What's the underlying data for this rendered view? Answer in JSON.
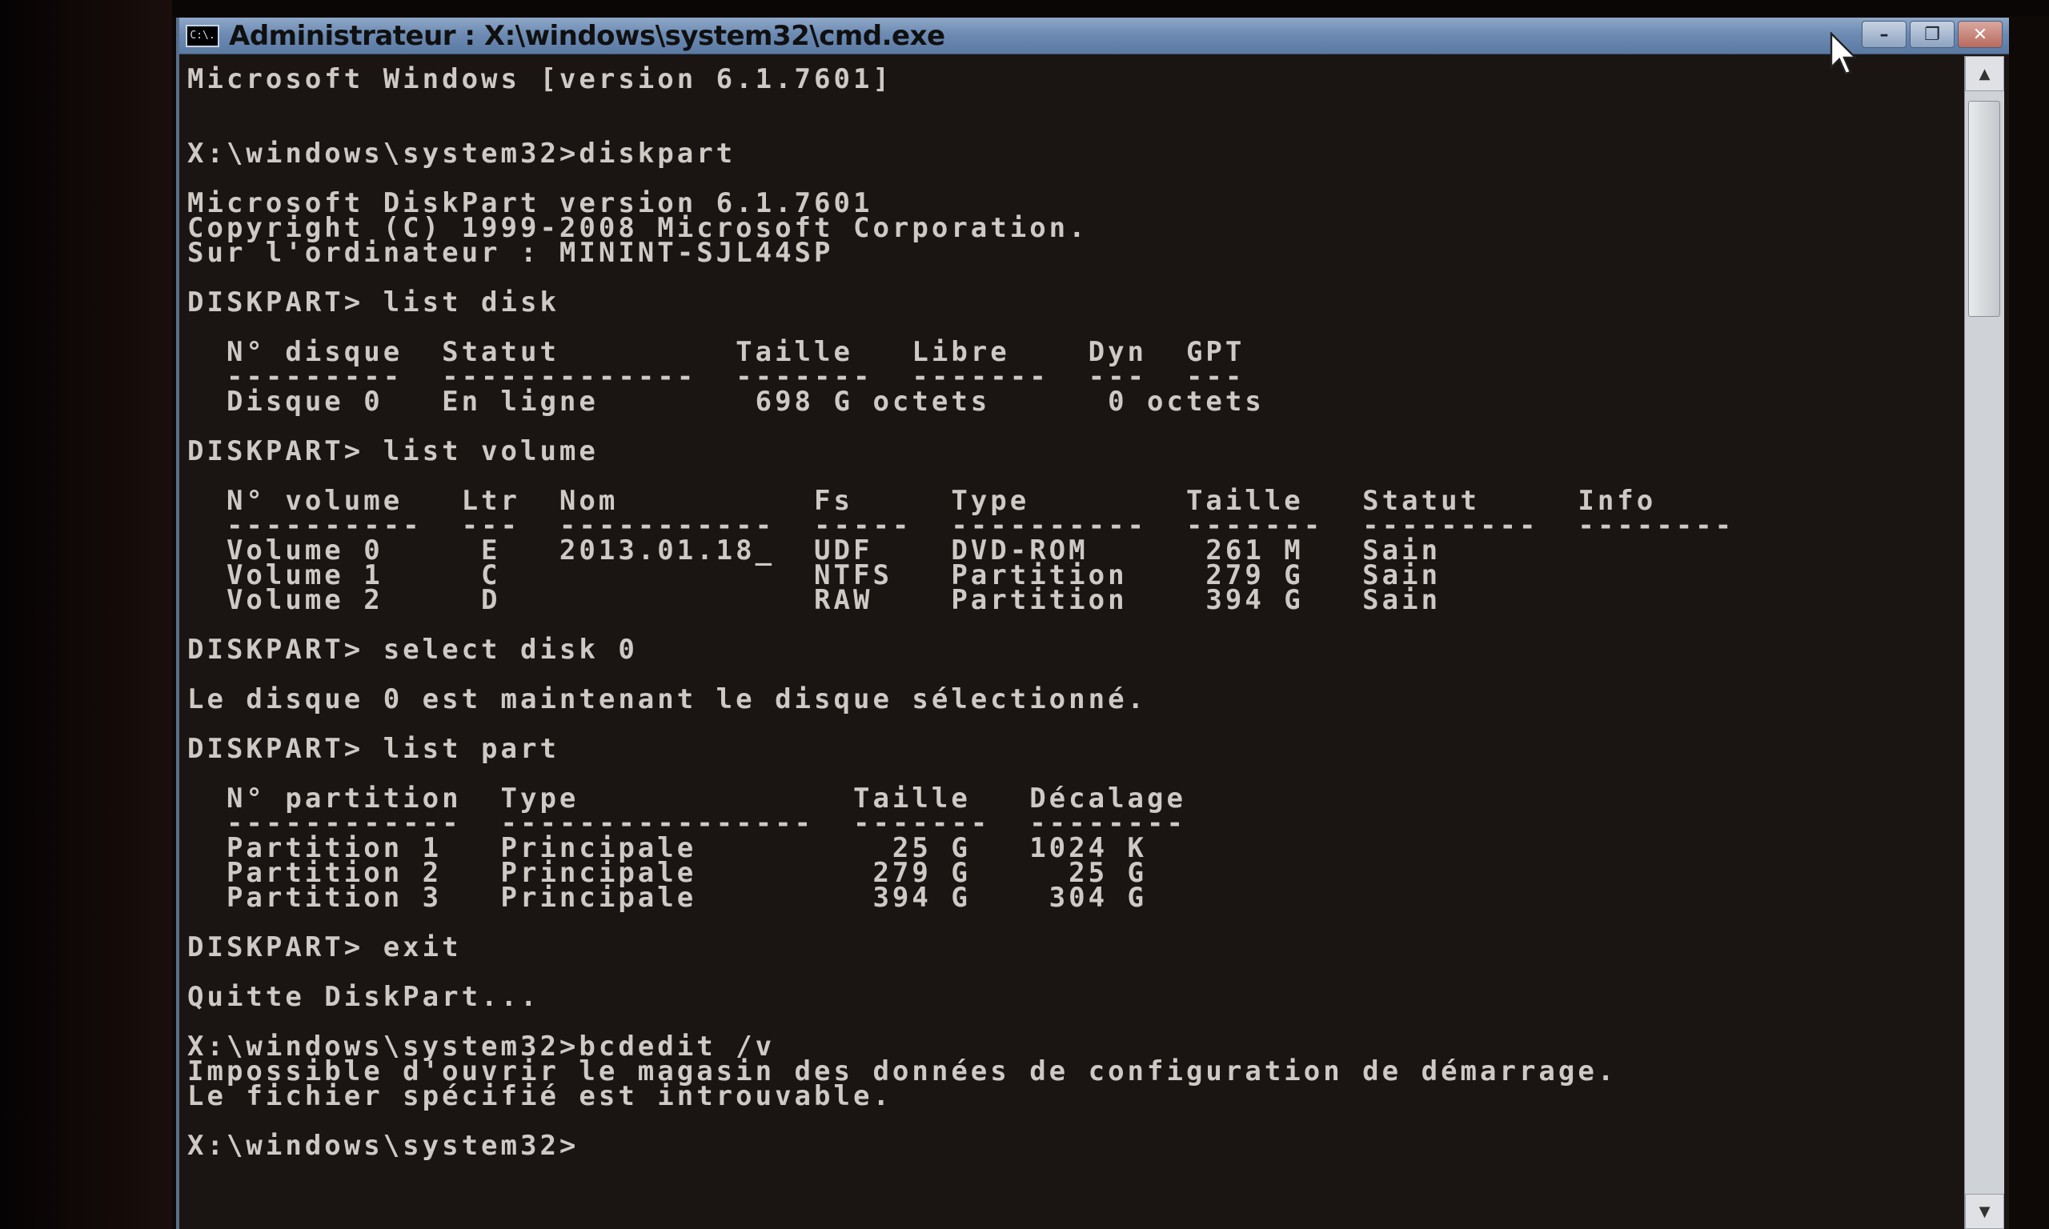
{
  "window": {
    "icon_label": "C:\\.",
    "title": "Administrateur : X:\\windows\\system32\\cmd.exe",
    "minimize_label": "–",
    "maximize_label": "❐",
    "close_label": "✕"
  },
  "scrollbar": {
    "up_label": "▲",
    "down_label": "▼"
  },
  "console": {
    "lines": [
      "Microsoft Windows [version 6.1.7601]",
      "",
      "",
      "X:\\windows\\system32>diskpart",
      "",
      "Microsoft DiskPart version 6.1.7601",
      "Copyright (C) 1999-2008 Microsoft Corporation.",
      "Sur l'ordinateur : MININT-SJL44SP",
      "",
      "DISKPART> list disk",
      "",
      "  N° disque  Statut         Taille   Libre    Dyn  GPT",
      "  ---------  -------------  -------  -------  ---  ---",
      "  Disque 0   En ligne        698 G octets      0 octets",
      "",
      "DISKPART> list volume",
      "",
      "  N° volume   Ltr  Nom          Fs     Type        Taille   Statut     Info",
      "  ----------  ---  -----------  -----  ----------  -------  ---------  --------",
      "  Volume 0     E   2013.01.18_  UDF    DVD-ROM      261 M   Sain",
      "  Volume 1     C                NTFS   Partition    279 G   Sain",
      "  Volume 2     D                RAW    Partition    394 G   Sain",
      "",
      "DISKPART> select disk 0",
      "",
      "Le disque 0 est maintenant le disque sélectionné.",
      "",
      "DISKPART> list part",
      "",
      "  N° partition  Type              Taille   Décalage",
      "  ------------  ----------------  -------  --------",
      "  Partition 1   Principale          25 G   1024 K",
      "  Partition 2   Principale         279 G     25 G",
      "  Partition 3   Principale         394 G    304 G",
      "",
      "DISKPART> exit",
      "",
      "Quitte DiskPart...",
      "",
      "X:\\windows\\system32>bcdedit /v",
      "Impossible d'ouvrir le magasin des données de configuration de démarrage.",
      "Le fichier spécifié est introuvable.",
      "",
      "X:\\windows\\system32>"
    ]
  },
  "colors": {
    "console_text": "#cfc9c6",
    "console_background": "#1a1512",
    "titlebar": "#6d8bb3"
  },
  "icons": {
    "app": "cmd-icon",
    "pointer": "mouse-pointer-icon"
  }
}
